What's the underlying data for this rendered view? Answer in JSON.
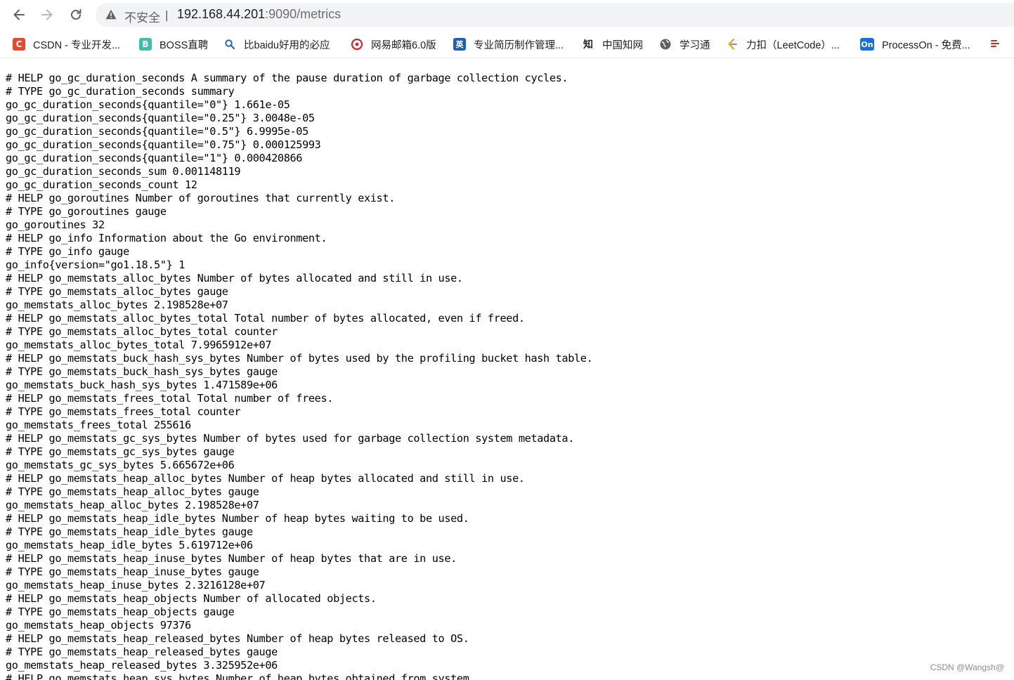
{
  "toolbar": {
    "security_label": "不安全",
    "separator": "|",
    "url_host": "192.168.44.201",
    "url_rest": ":9090/metrics"
  },
  "bookmarks": [
    {
      "label": "CSDN - 专业开发...",
      "icon": "csdn-icon",
      "glyph": "C",
      "color": "#e8492c"
    },
    {
      "label": "BOSS直聘",
      "icon": "boss-icon",
      "glyph": "B",
      "color": "#3cbfa8"
    },
    {
      "label": "比baidu好用的必应",
      "icon": "search-icon",
      "glyph": "",
      "color": "#2b5cd6"
    },
    {
      "label": "网易邮箱6.0版",
      "icon": "netease-mail-icon",
      "glyph": "",
      "color": "#d9232a"
    },
    {
      "label": "专业简历制作管理...",
      "icon": "resume-icon",
      "glyph": "英",
      "color": "#1f5fb5"
    },
    {
      "label": "中国知网",
      "icon": "cnki-icon",
      "glyph": "知",
      "color": "#222222"
    },
    {
      "label": "学习通",
      "icon": "globe-icon",
      "glyph": "",
      "color": "#5f6368"
    },
    {
      "label": "力扣（LeetCode）...",
      "icon": "leetcode-icon",
      "glyph": "",
      "color": "#f0a020"
    },
    {
      "label": "ProcessOn - 免费...",
      "icon": "processon-icon",
      "glyph": "On",
      "color": "#1a6fe0"
    },
    {
      "label": "",
      "icon": "bookmark-overflow-icon",
      "glyph": "",
      "color": "#c03020"
    }
  ],
  "metrics_lines": [
    "# HELP go_gc_duration_seconds A summary of the pause duration of garbage collection cycles.",
    "# TYPE go_gc_duration_seconds summary",
    "go_gc_duration_seconds{quantile=\"0\"} 1.661e-05",
    "go_gc_duration_seconds{quantile=\"0.25\"} 3.0048e-05",
    "go_gc_duration_seconds{quantile=\"0.5\"} 6.9995e-05",
    "go_gc_duration_seconds{quantile=\"0.75\"} 0.000125993",
    "go_gc_duration_seconds{quantile=\"1\"} 0.000420866",
    "go_gc_duration_seconds_sum 0.001148119",
    "go_gc_duration_seconds_count 12",
    "# HELP go_goroutines Number of goroutines that currently exist.",
    "# TYPE go_goroutines gauge",
    "go_goroutines 32",
    "# HELP go_info Information about the Go environment.",
    "# TYPE go_info gauge",
    "go_info{version=\"go1.18.5\"} 1",
    "# HELP go_memstats_alloc_bytes Number of bytes allocated and still in use.",
    "# TYPE go_memstats_alloc_bytes gauge",
    "go_memstats_alloc_bytes 2.198528e+07",
    "# HELP go_memstats_alloc_bytes_total Total number of bytes allocated, even if freed.",
    "# TYPE go_memstats_alloc_bytes_total counter",
    "go_memstats_alloc_bytes_total 7.9965912e+07",
    "# HELP go_memstats_buck_hash_sys_bytes Number of bytes used by the profiling bucket hash table.",
    "# TYPE go_memstats_buck_hash_sys_bytes gauge",
    "go_memstats_buck_hash_sys_bytes 1.471589e+06",
    "# HELP go_memstats_frees_total Total number of frees.",
    "# TYPE go_memstats_frees_total counter",
    "go_memstats_frees_total 255616",
    "# HELP go_memstats_gc_sys_bytes Number of bytes used for garbage collection system metadata.",
    "# TYPE go_memstats_gc_sys_bytes gauge",
    "go_memstats_gc_sys_bytes 5.665672e+06",
    "# HELP go_memstats_heap_alloc_bytes Number of heap bytes allocated and still in use.",
    "# TYPE go_memstats_heap_alloc_bytes gauge",
    "go_memstats_heap_alloc_bytes 2.198528e+07",
    "# HELP go_memstats_heap_idle_bytes Number of heap bytes waiting to be used.",
    "# TYPE go_memstats_heap_idle_bytes gauge",
    "go_memstats_heap_idle_bytes 5.619712e+06",
    "# HELP go_memstats_heap_inuse_bytes Number of heap bytes that are in use.",
    "# TYPE go_memstats_heap_inuse_bytes gauge",
    "go_memstats_heap_inuse_bytes 2.3216128e+07",
    "# HELP go_memstats_heap_objects Number of allocated objects.",
    "# TYPE go_memstats_heap_objects gauge",
    "go_memstats_heap_objects 97376",
    "# HELP go_memstats_heap_released_bytes Number of heap bytes released to OS.",
    "# TYPE go_memstats_heap_released_bytes gauge",
    "go_memstats_heap_released_bytes 3.325952e+06",
    "# HELP go_memstats_heap_sys_bytes Number of heap bytes obtained from system."
  ],
  "watermark": "CSDN @Wangsh@"
}
